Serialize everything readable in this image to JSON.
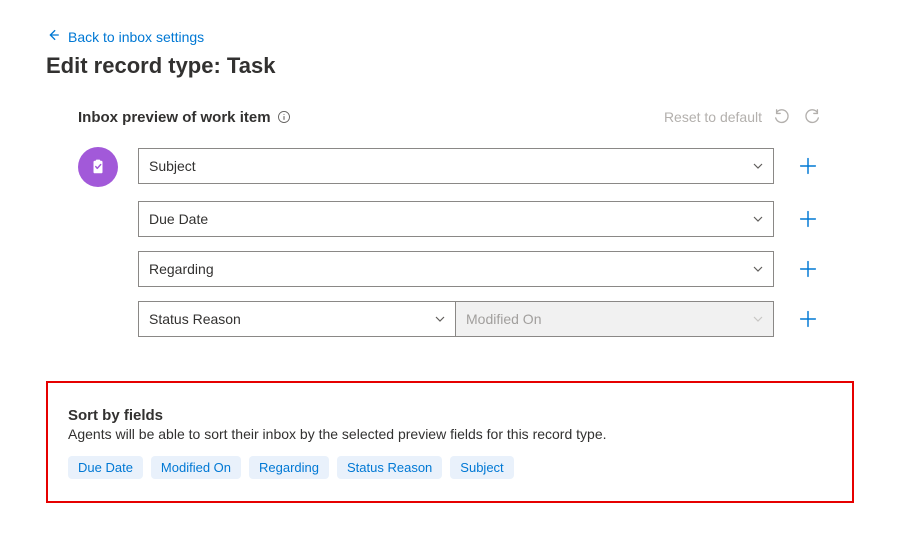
{
  "back": {
    "label": "Back to inbox settings"
  },
  "page_title": "Edit record type: Task",
  "preview": {
    "title": "Inbox preview of work item",
    "reset_label": "Reset to default",
    "rows": [
      {
        "primary": "Subject"
      },
      {
        "primary": "Due Date"
      },
      {
        "primary": "Regarding"
      },
      {
        "primary": "Status Reason",
        "secondary": "Modified On",
        "secondary_disabled": true,
        "split": true
      }
    ]
  },
  "sort": {
    "title": "Sort by fields",
    "description": "Agents will be able to sort their inbox by the selected preview fields for this record type.",
    "pills": [
      "Due Date",
      "Modified On",
      "Regarding",
      "Status Reason",
      "Subject"
    ]
  }
}
